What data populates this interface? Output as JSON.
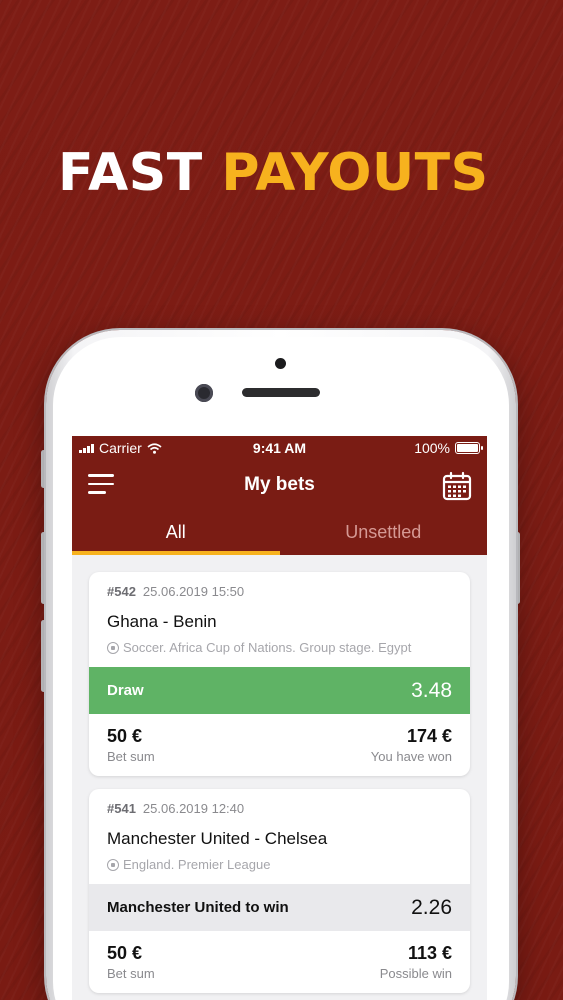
{
  "headline": {
    "word1": "FAST",
    "word2": "PAYOUTS"
  },
  "status": {
    "carrier": "Carrier",
    "time": "9:41 AM",
    "battery": "100%"
  },
  "header": {
    "title": "My bets"
  },
  "tabs": [
    {
      "label": "All"
    },
    {
      "label": "Unsettled"
    }
  ],
  "bets": [
    {
      "id": "#542",
      "datetime": "25.06.2019 15:50",
      "match": "Ghana - Benin",
      "league": "Soccer. Africa Cup of Nations. Group stage. Egypt",
      "outcome": "Draw",
      "odds": "3.48",
      "bet_sum": "50 €",
      "bet_sum_label": "Bet sum",
      "result": "174 €",
      "result_label": "You have won"
    },
    {
      "id": "#541",
      "datetime": "25.06.2019 12:40",
      "match": "Manchester United - Chelsea",
      "league": "England. Premier League",
      "outcome": "Manchester United to win",
      "odds": "2.26",
      "bet_sum": "50 €",
      "bet_sum_label": "Bet sum",
      "result": "113 €",
      "result_label": "Possible win"
    }
  ],
  "colors": {
    "accent": "#f7b21e",
    "brand": "#7a1c14",
    "won": "#5fb365"
  }
}
